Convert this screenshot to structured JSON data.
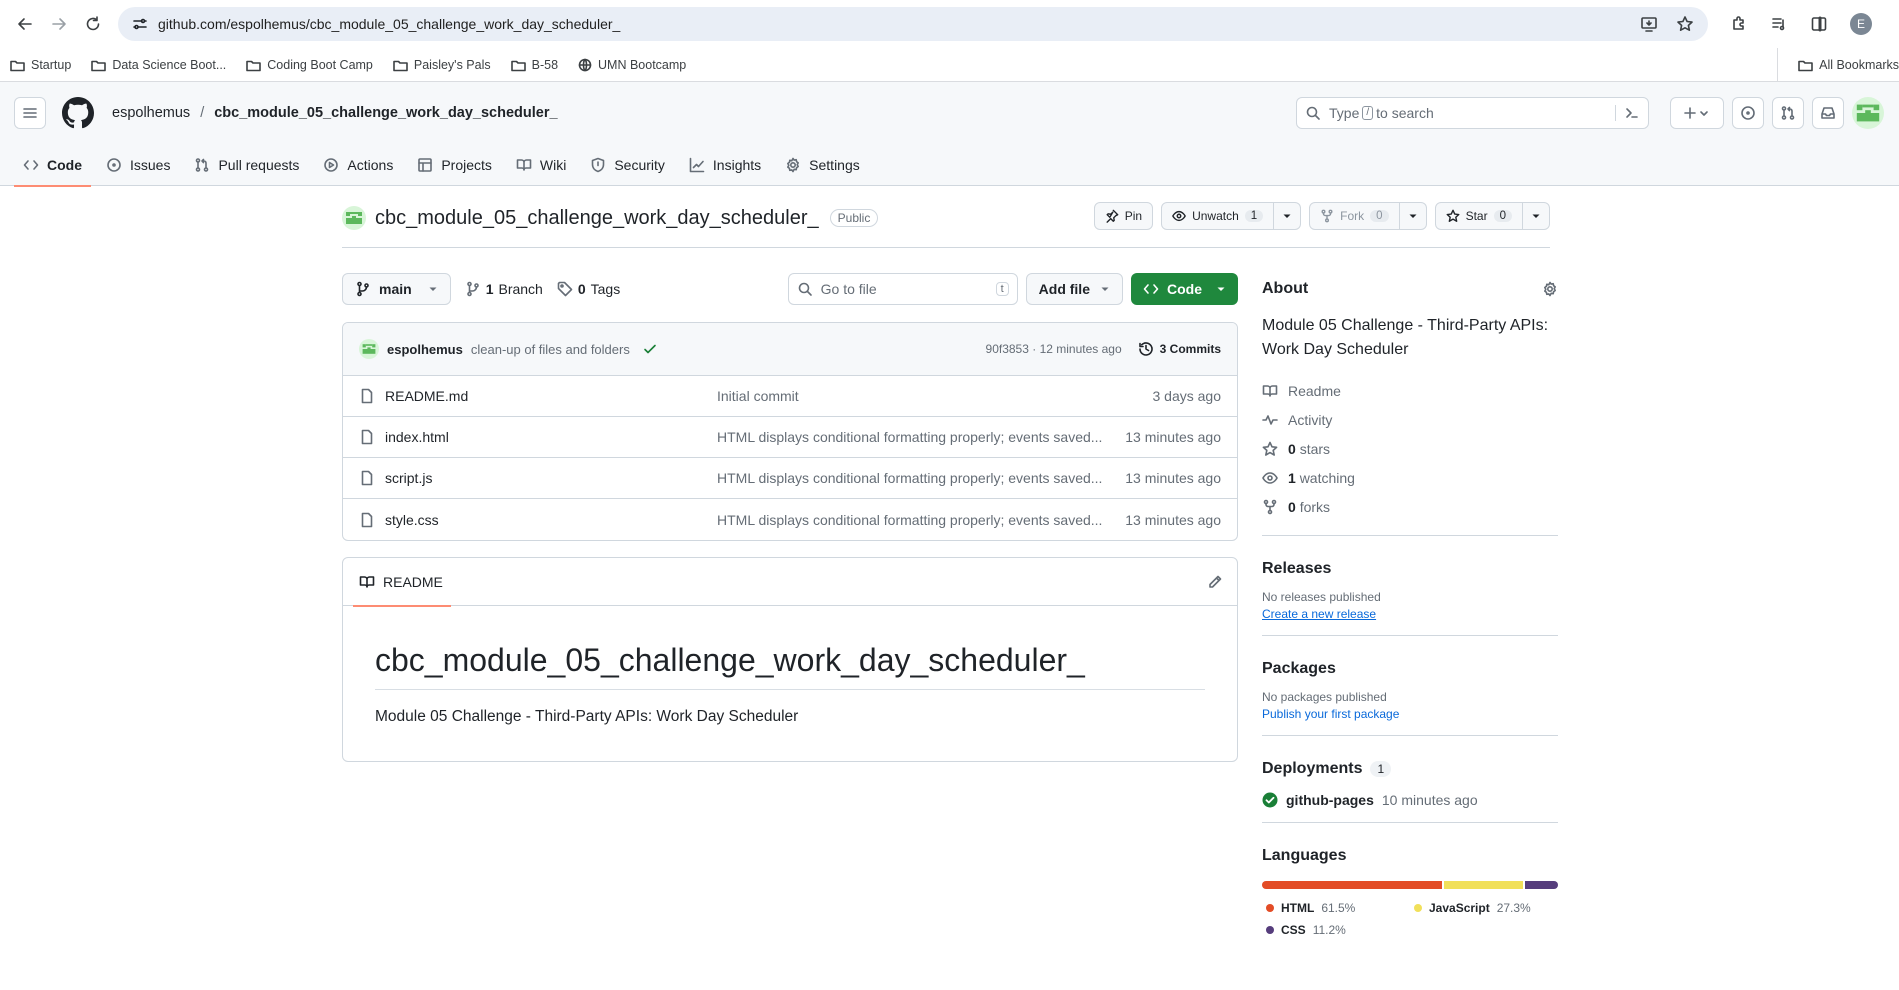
{
  "browser": {
    "url": "github.com/espolhemus/cbc_module_05_challenge_work_day_scheduler_",
    "profile_initial": "E",
    "bookmarks": [
      {
        "label": "Startup",
        "icon": "folder-icon"
      },
      {
        "label": "Data Science Boot...",
        "icon": "folder-icon"
      },
      {
        "label": "Coding Boot Camp",
        "icon": "folder-icon"
      },
      {
        "label": "Paisley's Pals",
        "icon": "folder-icon"
      },
      {
        "label": "B-58",
        "icon": "folder-icon"
      },
      {
        "label": "UMN Bootcamp",
        "icon": "globe-icon"
      }
    ],
    "all_bookmarks": "All Bookmarks"
  },
  "header": {
    "owner": "espolhemus",
    "separator": "/",
    "repo": "cbc_module_05_challenge_work_day_scheduler_",
    "search_before": "Type",
    "search_key": "/",
    "search_after": "to search"
  },
  "tabs": [
    {
      "label": "Code",
      "icon": "code-icon",
      "active": true
    },
    {
      "label": "Issues",
      "icon": "issue-icon"
    },
    {
      "label": "Pull requests",
      "icon": "pull-request-icon"
    },
    {
      "label": "Actions",
      "icon": "play-icon"
    },
    {
      "label": "Projects",
      "icon": "table-icon"
    },
    {
      "label": "Wiki",
      "icon": "book-icon"
    },
    {
      "label": "Security",
      "icon": "shield-icon"
    },
    {
      "label": "Insights",
      "icon": "graph-icon"
    },
    {
      "label": "Settings",
      "icon": "gear-icon"
    }
  ],
  "repo": {
    "name": "cbc_module_05_challenge_work_day_scheduler_",
    "visibility": "Public",
    "pin": "Pin",
    "unwatch": "Unwatch",
    "watch_count": "1",
    "fork": "Fork",
    "fork_count": "0",
    "star": "Star",
    "star_count": "0"
  },
  "filenav": {
    "branch": "main",
    "branches_count": "1",
    "branches_label": "Branch",
    "tags_count": "0",
    "tags_label": "Tags",
    "goto_placeholder": "Go to file",
    "goto_key": "t",
    "add_file": "Add file",
    "code": "Code"
  },
  "commit": {
    "author": "espolhemus",
    "message": "clean-up of files and folders",
    "hash_time": "90f3853 · 12 minutes ago",
    "commits": "3 Commits"
  },
  "files": [
    {
      "name": "README.md",
      "message": "Initial commit",
      "date": "3 days ago"
    },
    {
      "name": "index.html",
      "message": "HTML displays conditional formatting properly; events saved...",
      "date": "13 minutes ago"
    },
    {
      "name": "script.js",
      "message": "HTML displays conditional formatting properly; events saved...",
      "date": "13 minutes ago"
    },
    {
      "name": "style.css",
      "message": "HTML displays conditional formatting properly; events saved...",
      "date": "13 minutes ago"
    }
  ],
  "readme": {
    "tab": "README",
    "heading": "cbc_module_05_challenge_work_day_scheduler_",
    "paragraph": "Module 05 Challenge - Third-Party APIs: Work Day Scheduler"
  },
  "about": {
    "title": "About",
    "description": "Module 05 Challenge - Third-Party APIs: Work Day Scheduler",
    "readme": "Readme",
    "activity": "Activity",
    "stars_count": "0",
    "stars_label": "stars",
    "watching_count": "1",
    "watching_label": "watching",
    "forks_count": "0",
    "forks_label": "forks"
  },
  "releases": {
    "title": "Releases",
    "empty": "No releases published",
    "link": "Create a new release"
  },
  "packages": {
    "title": "Packages",
    "empty": "No packages published",
    "link": "Publish your first package"
  },
  "deployments": {
    "title": "Deployments",
    "count": "1",
    "env": "github-pages",
    "when": "10 minutes ago"
  },
  "languages": {
    "title": "Languages",
    "items": [
      {
        "name": "HTML",
        "percent": "61.5%",
        "value": 61.5,
        "color": "#e34c26"
      },
      {
        "name": "JavaScript",
        "percent": "27.3%",
        "value": 27.3,
        "color": "#f1e05a"
      },
      {
        "name": "CSS",
        "percent": "11.2%",
        "value": 11.2,
        "color": "#563d7c"
      }
    ]
  }
}
